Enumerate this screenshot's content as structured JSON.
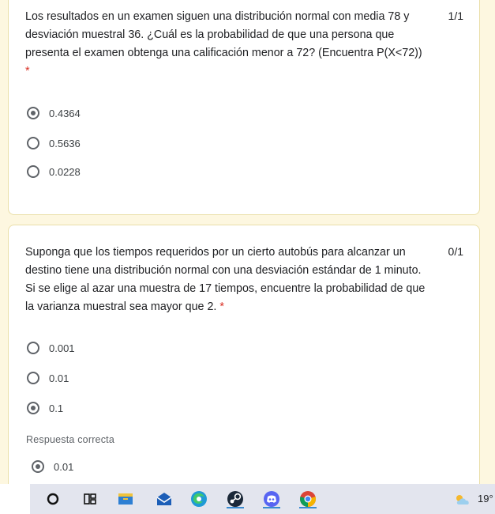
{
  "question1": {
    "text": "Los resultados en un examen siguen una distribución normal con media 78 y desviación muestral 36. ¿Cuál es la probabilidad de que una persona que presenta el examen obtenga una calificación menor a 72? (Encuentra P(X<72))",
    "required_mark": "*",
    "score": "1/1",
    "options": [
      {
        "label": "0.4364",
        "selected": true
      },
      {
        "label": "0.5636",
        "selected": false
      },
      {
        "label": "0.0228",
        "selected": false
      }
    ]
  },
  "question2": {
    "text": "Suponga que los tiempos requeridos por un cierto autobús para alcanzar un destino tiene una distribución normal con una desviación estándar de 1 minuto. Si se elige al azar una muestra de 17 tiempos, encuentre la probabilidad de que la varianza muestral sea mayor que 2.",
    "required_mark": "*",
    "score": "0/1",
    "options": [
      {
        "label": "0.001",
        "selected": false
      },
      {
        "label": "0.01",
        "selected": false
      },
      {
        "label": "0.1",
        "selected": true
      }
    ],
    "correct_answer_label": "Respuesta correcta",
    "correct_answer": {
      "label": "0.01",
      "selected": true
    }
  },
  "taskbar": {
    "icons": [
      "search-circle-icon",
      "task-view-icon",
      "file-explorer-icon",
      "mail-icon",
      "edge-icon",
      "steam-icon",
      "discord-icon",
      "chrome-icon"
    ],
    "accent": "#3a8bd1",
    "weather": {
      "temperature": "19°",
      "icon": "cloudy-sun-icon"
    }
  },
  "colors": {
    "background": "#fdf7e0",
    "required": "#d93025",
    "radio": "#5f6368"
  }
}
